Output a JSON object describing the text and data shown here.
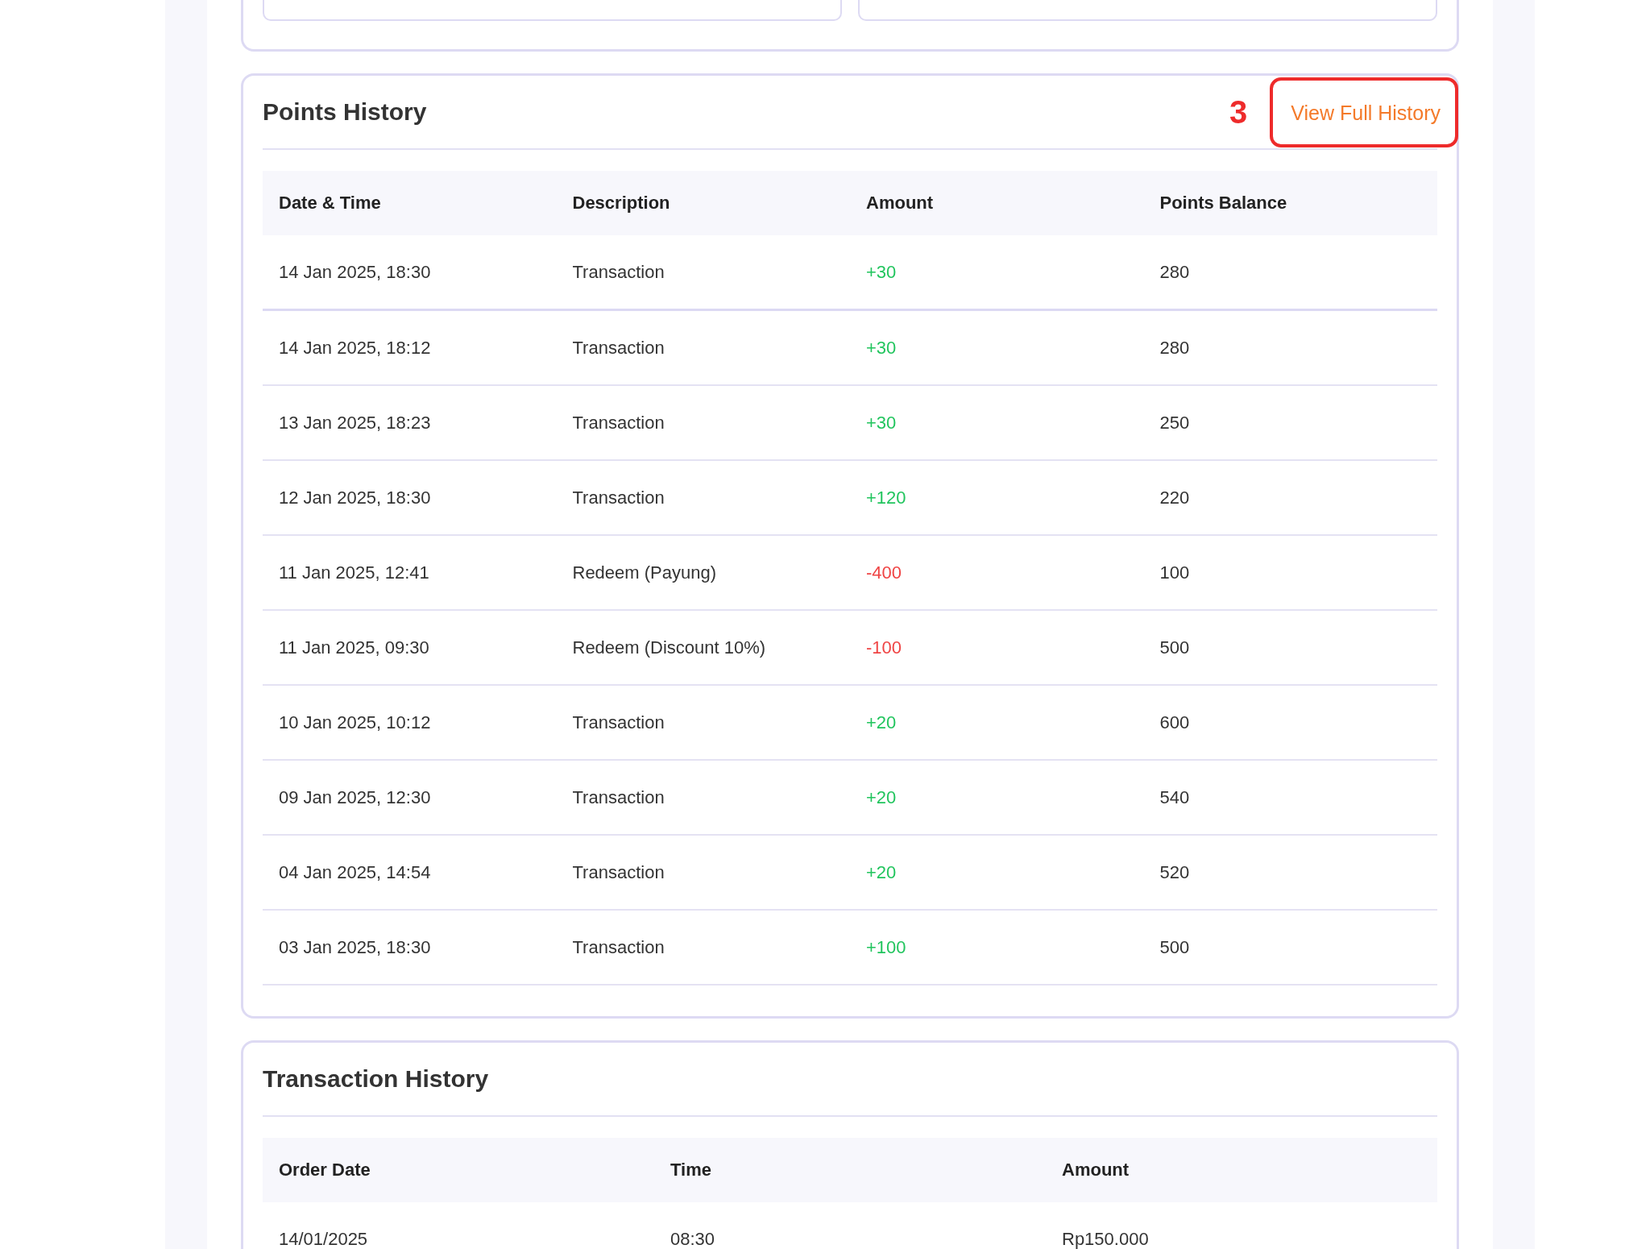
{
  "top_card": {
    "fields": [
      {
        "kind": "field"
      },
      {
        "kind": "field"
      }
    ]
  },
  "points_history": {
    "title": "Points History",
    "link": {
      "label": "View Full History",
      "highlighted": true,
      "annotation": "3"
    },
    "columns": [
      "Date & Time",
      "Description",
      "Amount",
      "Points Balance"
    ],
    "rows": [
      {
        "date": "14 Jan 2025, 18:30",
        "description": "Transaction",
        "amount": "+30",
        "kind": "credit",
        "balance": "280"
      },
      {
        "date": "14 Jan 2025, 18:12",
        "description": "Transaction",
        "amount": "+30",
        "kind": "credit",
        "balance": "280"
      },
      {
        "date": "13 Jan 2025, 18:23",
        "description": "Transaction",
        "amount": "+30",
        "kind": "credit",
        "balance": "250"
      },
      {
        "date": "12 Jan 2025, 18:30",
        "description": "Transaction",
        "amount": "+120",
        "kind": "credit",
        "balance": "220"
      },
      {
        "date": "11 Jan 2025, 12:41",
        "description": "Redeem (Payung)",
        "amount": "-400",
        "kind": "debit",
        "balance": "100"
      },
      {
        "date": "11 Jan 2025, 09:30",
        "description": "Redeem (Discount 10%)",
        "amount": "-100",
        "kind": "debit",
        "balance": "500"
      },
      {
        "date": "10 Jan 2025, 10:12",
        "description": "Transaction",
        "amount": "+20",
        "kind": "credit",
        "balance": "600"
      },
      {
        "date": "09 Jan 2025, 12:30",
        "description": "Transaction",
        "amount": "+20",
        "kind": "credit",
        "balance": "540"
      },
      {
        "date": "04 Jan 2025, 14:54",
        "description": "Transaction",
        "amount": "+20",
        "kind": "credit",
        "balance": "520"
      },
      {
        "date": "03 Jan 2025, 18:30",
        "description": "Transaction",
        "amount": "+100",
        "kind": "credit",
        "balance": "500"
      }
    ]
  },
  "transaction_history": {
    "title": "Transaction History",
    "columns": [
      "Order Date",
      "Time",
      "Amount"
    ],
    "rows": [
      {
        "cells": [
          "14/01/2025",
          "08:30",
          "Rp150.000"
        ]
      }
    ]
  }
}
